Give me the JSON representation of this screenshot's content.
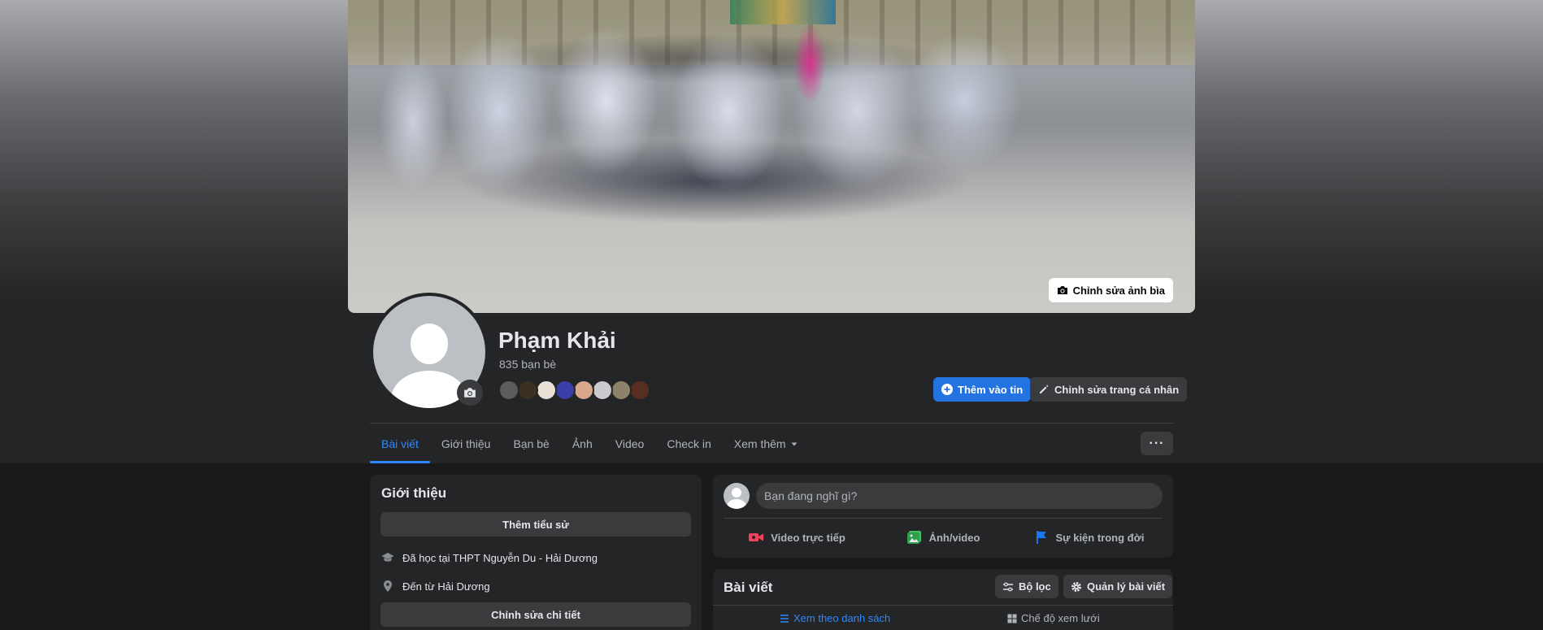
{
  "cover": {
    "edit_button_label": "Chỉnh sửa ảnh bìa"
  },
  "profile": {
    "name": "Phạm Khải",
    "friends_count_text": "835 bạn bè",
    "friend_avatar_colors": [
      "#5a5c5e",
      "#3b3022",
      "#e9e1d6",
      "#3a3fa8",
      "#d8a98f",
      "#c9cbcf",
      "#8c8369",
      "#5a2d22"
    ]
  },
  "actions": {
    "add_story_label": "Thêm vào tin",
    "edit_profile_label": "Chỉnh sửa trang cá nhân"
  },
  "tabs": [
    {
      "label": "Bài viết",
      "active": true
    },
    {
      "label": "Giới thiệu",
      "active": false
    },
    {
      "label": "Bạn bè",
      "active": false
    },
    {
      "label": "Ảnh",
      "active": false
    },
    {
      "label": "Video",
      "active": false
    },
    {
      "label": "Check in",
      "active": false
    },
    {
      "label": "Xem thêm",
      "active": false
    }
  ],
  "more_button_label": "···",
  "intro": {
    "title": "Giới thiệu",
    "add_bio_label": "Thêm tiểu sử",
    "studied_at": "Đã học tại THPT Nguyễn Du - Hải Dương",
    "from": "Đến từ Hải Dương",
    "edit_details_label": "Chỉnh sửa chi tiết"
  },
  "composer": {
    "placeholder": "Bạn đang nghĩ gì?",
    "actions": [
      {
        "label": "Video trực tiếp",
        "icon": "live-video-icon",
        "color": "#f3425f"
      },
      {
        "label": "Ảnh/video",
        "icon": "photo-video-icon",
        "color": "#45bd62"
      },
      {
        "label": "Sự kiện trong đời",
        "icon": "life-event-flag-icon",
        "color": "#1877f2"
      }
    ]
  },
  "posts": {
    "title": "Bài viết",
    "filter_label": "Bộ lọc",
    "manage_label": "Quản lý bài viết",
    "list_view_label": "Xem theo danh sách",
    "grid_view_label": "Chế độ xem lưới"
  },
  "colors": {
    "accent": "#2d88ff",
    "primary_button": "#2374e1",
    "background": "#18191a",
    "surface": "#242526"
  }
}
